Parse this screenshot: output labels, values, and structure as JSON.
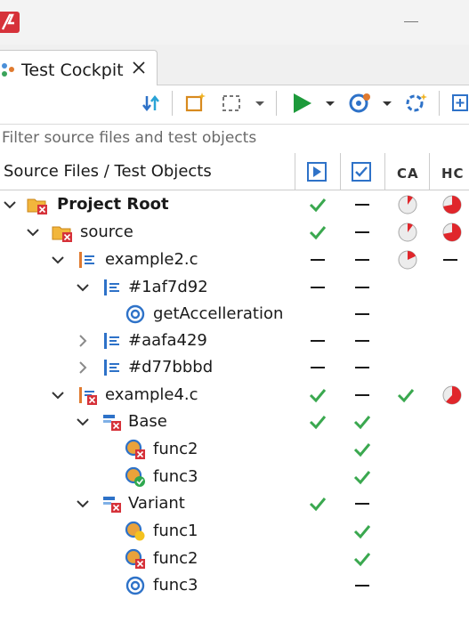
{
  "tab": {
    "title": "Test Cockpit"
  },
  "filter": {
    "placeholder": "Filter source files and test objects"
  },
  "columns": {
    "tree": "Source Files / Test Objects",
    "ca": "CA",
    "hc": "HC"
  },
  "tree": [
    {
      "label": "Project Root",
      "expanded": true,
      "icon": "project-folder-icon",
      "run": "check",
      "result": "dash",
      "ca_fraction": 0.1,
      "hc_fraction": 0.72
    },
    {
      "label": "source",
      "expanded": true,
      "icon": "source-folder-icon",
      "run": "check",
      "result": "dash",
      "ca_fraction": 0.1,
      "hc_fraction": 0.72
    },
    {
      "label": "example2.c",
      "expanded": true,
      "icon": "source-file-icon",
      "run": "dash",
      "result": "dash",
      "ca_fraction": 0.18,
      "hc": "dash"
    },
    {
      "label": "#1af7d92",
      "expanded": true,
      "icon": "module-icon",
      "run": "dash",
      "result": "dash"
    },
    {
      "label": "getAccelleration",
      "icon": "function-target-icon",
      "result": "dash"
    },
    {
      "label": "#aafa429",
      "expanded": false,
      "icon": "module-icon",
      "run": "dash",
      "result": "dash"
    },
    {
      "label": "#d77bbbd",
      "expanded": false,
      "icon": "module-icon",
      "run": "dash",
      "result": "dash"
    },
    {
      "label": "example4.c",
      "expanded": true,
      "icon": "source-file-error-icon",
      "run": "check",
      "result": "dash",
      "ca": "check",
      "hc_fraction": 0.62
    },
    {
      "label": "Base",
      "expanded": true,
      "icon": "variant-error-icon",
      "run": "check",
      "result": "check"
    },
    {
      "label": "func2",
      "icon": "function-failed-icon",
      "result": "check"
    },
    {
      "label": "func3",
      "icon": "function-passed-icon",
      "result": "check"
    },
    {
      "label": "Variant",
      "expanded": true,
      "icon": "variant-error-icon",
      "run": "check",
      "result": "dash"
    },
    {
      "label": "func1",
      "icon": "function-warning-icon",
      "result": "check"
    },
    {
      "label": "func2",
      "icon": "function-failed-icon",
      "result": "check"
    },
    {
      "label": "func3",
      "icon": "function-target-icon",
      "result": "dash"
    }
  ]
}
